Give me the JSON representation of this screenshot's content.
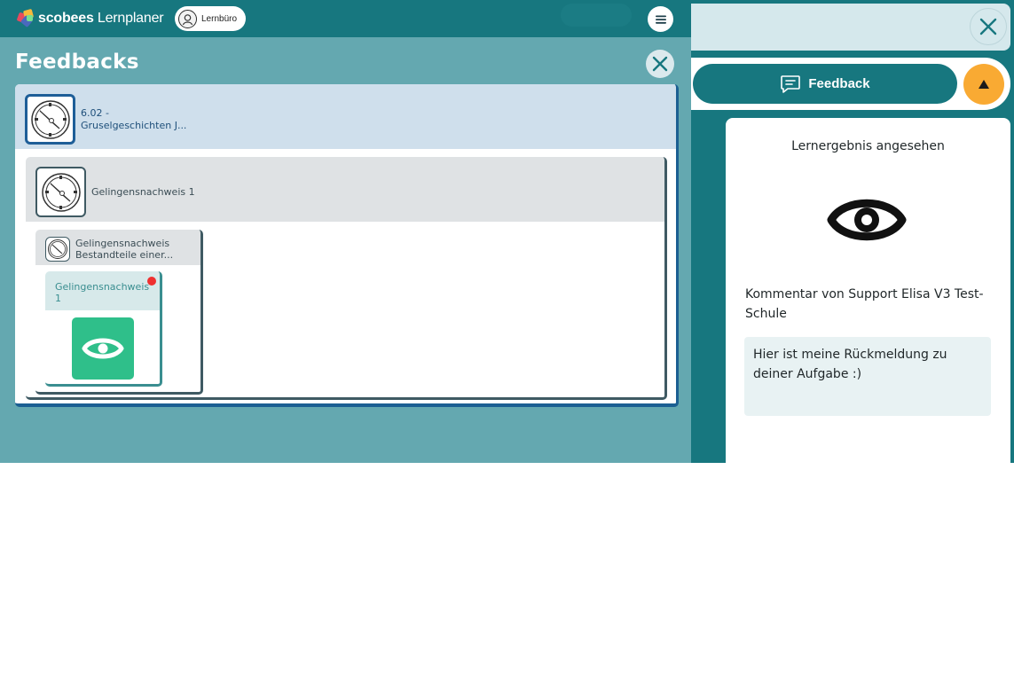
{
  "app": {
    "brand_bold": "scobees",
    "brand_light": "Lernplaner",
    "workspace_pill": "Lernbüro",
    "menu_icon": "hamburger-menu-icon"
  },
  "feedbacks": {
    "title": "Feedbacks",
    "close_icon": "close-icon",
    "course": {
      "code": "6.02 -",
      "name": "Gruselgeschichten J..."
    },
    "section": {
      "label": "Gelingensnachweis 1"
    },
    "subsection": {
      "line1": "Gelingensnachweis",
      "line2": "Bestandteile einer..."
    },
    "item": {
      "line1": "Gelingensnachweis",
      "line2": "1",
      "has_notification": true,
      "icon": "eye-icon"
    }
  },
  "detail": {
    "close_icon": "close-icon",
    "feedback_button": "Feedback",
    "collapse_icon": "triangle-up-icon",
    "status": "Lernergebnis angesehen",
    "status_icon": "eye-icon",
    "comment_header": "Kommentar von Support Elisa V3 Test-Schule",
    "comment_text": "Hier ist meine Rückmeldung zu deiner Aufgabe :)"
  },
  "colors": {
    "teal_dark": "#17777f",
    "teal_bg": "#64a8b0",
    "navy": "#1e5e98",
    "green": "#2fbf8a",
    "orange": "#f9aa33",
    "notification": "#ef3030"
  }
}
